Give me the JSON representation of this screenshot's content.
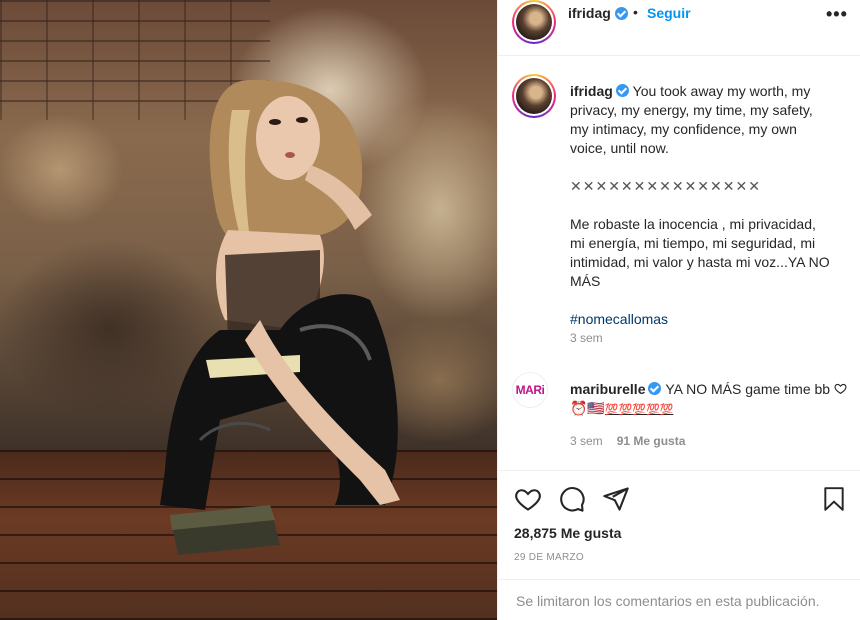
{
  "post": {
    "username": "ifridag",
    "dot": "•",
    "follow_label": "Seguir",
    "more_label": "•••"
  },
  "caption": {
    "username": "ifridag",
    "line1": "You took away my worth, my privacy, my energy, my time, my safety, my intimacy, my confidence, my own voice, until now.",
    "separator": "✕✕✕✕✕✕✕✕✕✕✕✕✕✕✕",
    "line2": "Me robaste la inocencia , mi privacidad, mi energía, mi tiempo, mi seguridad, mi intimidad, mi valor y hasta mi voz...YA NO MÁS",
    "hashtag": "#nomecallomas",
    "time": "3 sem"
  },
  "reply": {
    "avatar_text": "MARi",
    "username": "mariburelle",
    "text": "YA NO MÁS game time bb",
    "emoji_tail": "⏰🇺🇸",
    "hundreds": "💯💯💯💯💯",
    "time": "3 sem",
    "likes": "91 Me gusta"
  },
  "engagement": {
    "likes": "28,875 Me gusta",
    "date": "29 DE MARZO"
  },
  "comments_closed": "Se limitaron los comentarios en esta publicación.",
  "icons": [
    "heart-icon",
    "comment-icon",
    "share-icon",
    "bookmark-icon",
    "verified-badge-icon"
  ],
  "colors": {
    "link": "#0095f6",
    "verified": "#3897f0",
    "hashtag": "#00376b",
    "muted": "#8e8e8e"
  }
}
